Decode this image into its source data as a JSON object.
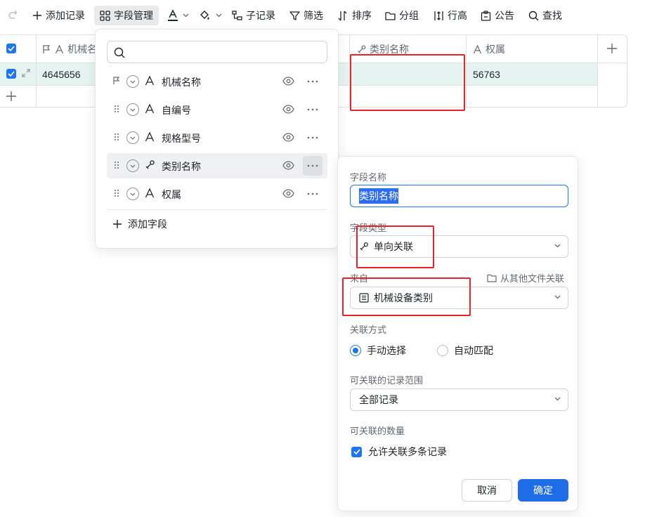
{
  "toolbar": {
    "add_record": "添加记录",
    "field_manage": "字段管理",
    "sub_record": "子记录",
    "filter": "筛选",
    "sort": "排序",
    "group": "分组",
    "row_height": "行高",
    "announcement": "公告",
    "search": "查找"
  },
  "grid": {
    "columns": [
      "机械名",
      "类别名称",
      "权属"
    ],
    "row": {
      "machine_name": "4645656",
      "category": "",
      "ownership": "56763"
    }
  },
  "field_manager": {
    "search_placeholder": "",
    "fields": [
      {
        "label": "机械名称",
        "type_icon": "text-icon",
        "primary": true
      },
      {
        "label": "自编号",
        "type_icon": "text-icon",
        "primary": false
      },
      {
        "label": "规格型号",
        "type_icon": "text-icon",
        "primary": false
      },
      {
        "label": "类别名称",
        "type_icon": "link-icon",
        "primary": false
      },
      {
        "label": "权属",
        "type_icon": "text-icon",
        "primary": false
      }
    ],
    "add_field": "添加字段"
  },
  "settings": {
    "field_name_label": "字段名称",
    "field_name_value": "类别名称",
    "field_type_label": "字段类型",
    "field_type_value": "单向关联",
    "source_label": "来自",
    "link_other_file": "从其他文件关联",
    "source_value": "机械设备类别",
    "link_mode_label": "关联方式",
    "mode_manual": "手动选择",
    "mode_auto": "自动匹配",
    "range_label": "可关联的记录范围",
    "range_value": "全部记录",
    "count_label": "可关联的数量",
    "allow_multiple": "允许关联多条记录",
    "allow_multiple_checked": true,
    "manual_selected": true,
    "cancel": "取消",
    "confirm": "确定"
  },
  "colors": {
    "accent": "#1f74f2",
    "annotation": "#e8232a",
    "row_highlight": "#e6f4f1"
  }
}
